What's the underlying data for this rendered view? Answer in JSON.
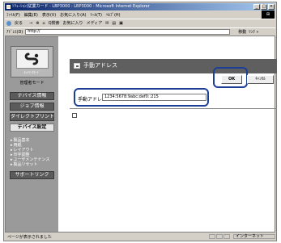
{
  "window": {
    "title": "ｿﾘｭｰｼｮﾝ(従業カード - LBP3000 : LBP3000 - Microsoft Internet Explorer",
    "controls": [
      "_",
      "□",
      "×"
    ]
  },
  "menu": [
    "ﾌｧｲﾙ(F)",
    "編集(E)",
    "表示(V)",
    "お気に入り(A)",
    "ﾂｰﾙ(T)",
    "ﾍﾙﾌﾟ(H)"
  ],
  "toolbar": {
    "back": "戻る",
    "items": [
      "→",
      "⊗",
      "⌂",
      "Q検索",
      "お気に入り",
      "メディア",
      "✉",
      "▤",
      "▣"
    ]
  },
  "address": {
    "label": "ｱﾄﾞﾚｽ(D)",
    "value": "http://",
    "go": "移動",
    "links": "ﾘﾝｸ »"
  },
  "sidebar": {
    "logo_sub": "ﾈｯﾄﾜｰｸｶｰﾄﾞ",
    "mode": "管理者モード",
    "nav": [
      {
        "label": "デバイス情報",
        "active": false
      },
      {
        "label": "ジョブ情報",
        "active": false
      },
      {
        "label": "ダイレクトプリント",
        "active": false
      },
      {
        "label": "デバイス設定",
        "active": true
      }
    ],
    "subitems": [
      "製品基本",
      "用紙",
      "レイアウト",
      "印字調整",
      "ユーザメンテナンス",
      "製品リセット"
    ],
    "support": "サポートリンク"
  },
  "page": {
    "title": "手動アドレス",
    "ok": "OK",
    "cancel": "ｷｬﾝｾﾙ",
    "field_label": "手動アドレス :",
    "field_value": "1234:5678:9abc:def0::215"
  },
  "status": {
    "text": "ページが表示されました",
    "zone": "インターネット"
  },
  "colors": {
    "highlight_ring": "#1c3e95",
    "sidebar_bg": "#9a9a9a",
    "header_bg": "#5f5f5f"
  }
}
